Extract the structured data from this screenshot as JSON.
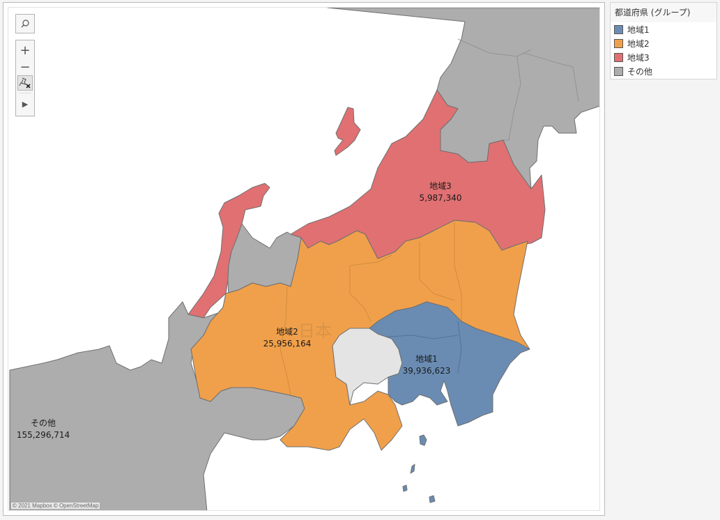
{
  "legend": {
    "title": "都道府県 (グループ)",
    "items": [
      {
        "label": "地域1",
        "color": "#6a8cb3"
      },
      {
        "label": "地域2",
        "color": "#f0a04b"
      },
      {
        "label": "地域3",
        "color": "#e07072"
      },
      {
        "label": "その他",
        "color": "#adadad"
      }
    ]
  },
  "map": {
    "watermark": "日本",
    "attribution": "© 2021 Mapbox © OpenStreetMap",
    "highlight_color": "#e4e4e4",
    "water_color": "#ffffff",
    "labels": [
      {
        "group": "地域1",
        "value": "39,936,623"
      },
      {
        "group": "地域2",
        "value": "25,956,164"
      },
      {
        "group": "地域3",
        "value": "5,987,340"
      },
      {
        "group": "その他",
        "value": "155,296,714"
      }
    ]
  },
  "controls": {
    "search": "search",
    "zoom_in": "+",
    "zoom_out": "−",
    "pin_reset": "reset-pin",
    "expand": "▶"
  }
}
